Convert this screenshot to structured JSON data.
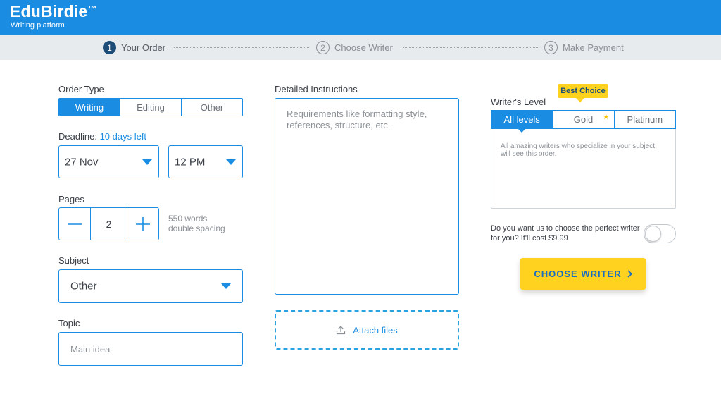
{
  "header": {
    "brand": "EduBirdie",
    "trademark": "™",
    "tagline": "Writing platform",
    "color": "#1a8ce2"
  },
  "steps": [
    {
      "number": "1",
      "label": "Your Order",
      "active": true
    },
    {
      "number": "2",
      "label": "Choose Writer",
      "active": false
    },
    {
      "number": "3",
      "label": "Make Payment",
      "active": false
    }
  ],
  "order_type": {
    "label": "Order Type",
    "options": [
      "Writing",
      "Editing",
      "Other"
    ],
    "selected": "Writing"
  },
  "deadline": {
    "label": "Deadline:",
    "note": "10 days left",
    "date": "27 Nov",
    "time": "12 PM"
  },
  "pages": {
    "label": "Pages",
    "value": "2",
    "hint_line1": "550 words",
    "hint_line2": "double spacing"
  },
  "subject": {
    "label": "Subject",
    "value": "Other"
  },
  "topic": {
    "label": "Topic",
    "placeholder": "Main idea"
  },
  "instructions": {
    "label": "Detailed Instructions",
    "placeholder": "Requirements like formatting style, references, structure, etc.",
    "attach_label": "Attach files"
  },
  "writer_level": {
    "label": "Writer's Level",
    "badge": "Best Choice",
    "options": [
      "All levels",
      "Gold",
      "Platinum"
    ],
    "selected": "All levels",
    "description": "All amazing writers who specialize in your subject will see this order."
  },
  "auto_choose": {
    "text": "Do you want us to choose the perfect writer for you? It'll cost $9.99",
    "enabled": false
  },
  "cta": {
    "label": "CHOOSE WRITER",
    "color": "#ffd21f"
  }
}
